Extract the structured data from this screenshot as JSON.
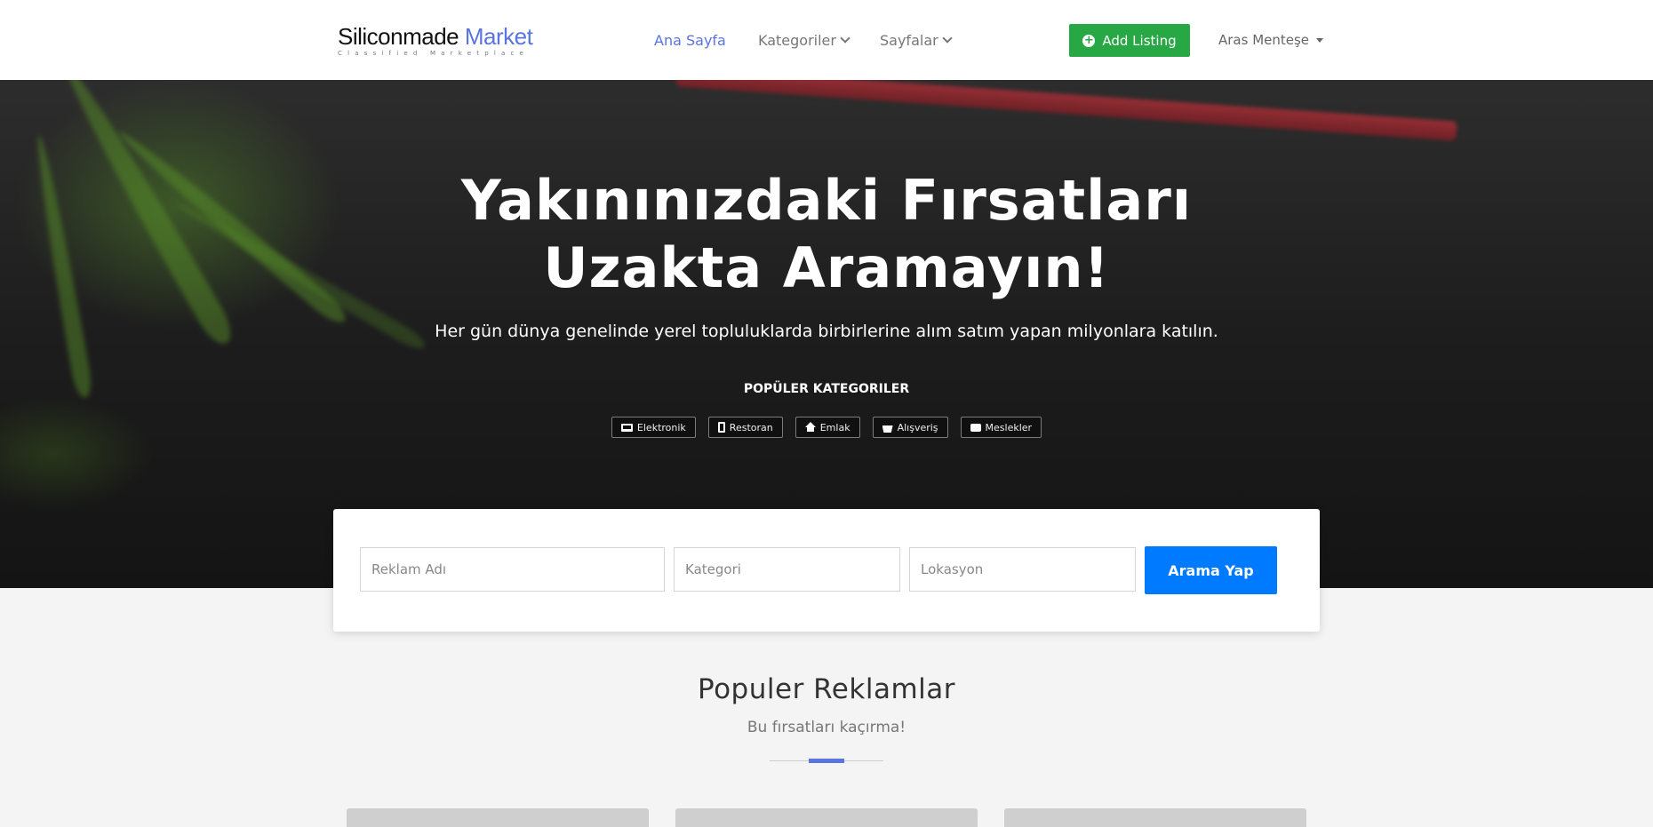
{
  "logo": {
    "brand": "Siliconmade",
    "accent": "Market",
    "tagline": "Classified Marketplace"
  },
  "nav": {
    "home": "Ana Sayfa",
    "categories": "Kategoriler",
    "pages": "Sayfalar"
  },
  "header": {
    "add_listing": "Add Listing",
    "user_name": "Aras Menteşe"
  },
  "hero": {
    "title_line1": "Yakınınızdaki Fırsatları",
    "title_line2": "Uzakta Aramayın!",
    "subtitle": "Her gün dünya genelinde yerel topluluklarda birbirlerine alım satım yapan milyonlara katılın.",
    "popular_title": "POPÜLER KATEGORILER",
    "categories": [
      {
        "label": "Elektronik",
        "icon": "laptop-icon"
      },
      {
        "label": "Restoran",
        "icon": "phone-icon"
      },
      {
        "label": "Emlak",
        "icon": "house-icon"
      },
      {
        "label": "Alışveriş",
        "icon": "basket-icon"
      },
      {
        "label": "Meslekler",
        "icon": "briefcase-icon"
      }
    ]
  },
  "search": {
    "ad_name_placeholder": "Reklam Adı",
    "category_placeholder": "Kategori",
    "location_placeholder": "Lokasyon",
    "button": "Arama Yap"
  },
  "popular": {
    "title": "Populer Reklamlar",
    "subtitle": "Bu fırsatları kaçırma!"
  },
  "colors": {
    "accent": "#5a74e0",
    "add_button": "#28a745",
    "search_button": "#007bff"
  }
}
